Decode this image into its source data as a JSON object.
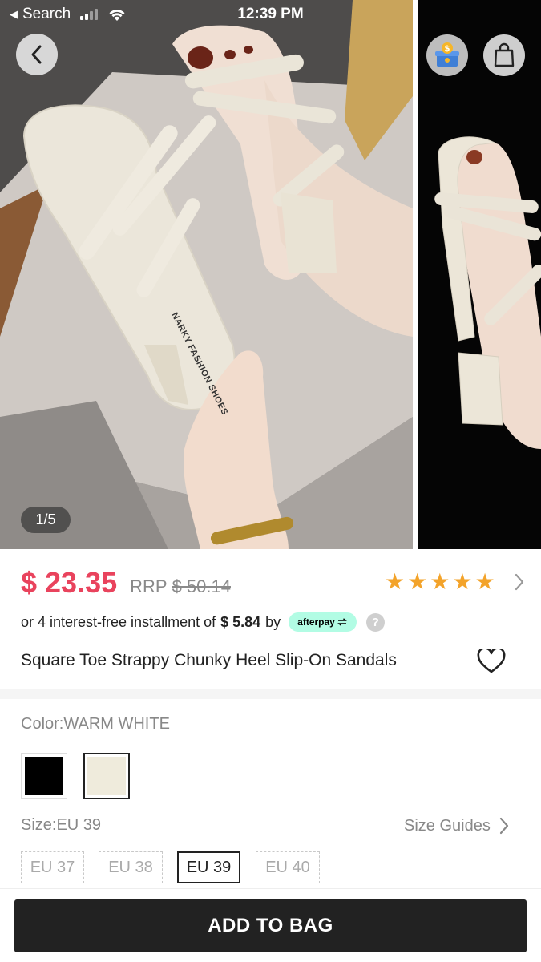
{
  "status_bar": {
    "back_app": "Search",
    "time": "12:39 PM"
  },
  "gallery": {
    "counter": "1/5",
    "insole_brand_text": "NARKY FASHION SHOES",
    "icons": {
      "back": "chevron-left-icon",
      "rewards": "gift-coin-icon",
      "bag": "shopping-bag-icon"
    }
  },
  "product": {
    "price": "$ 23.35",
    "rrp_label": "RRP",
    "rrp_value": "$ 50.14",
    "rating_stars": 5,
    "installment_prefix": "or 4 interest-free installment of",
    "installment_amount": "$ 5.84",
    "installment_by": "by",
    "afterpay_label": "afterpay",
    "title": "Square Toe Strappy Chunky Heel Slip-On Sandals"
  },
  "options": {
    "color_label": "Color:WARM WHITE",
    "colors": [
      {
        "name": "Black",
        "hex": "#000000",
        "selected": false
      },
      {
        "name": "Warm White",
        "hex": "#efebdc",
        "selected": true
      }
    ],
    "size_label": "Size:EU 39",
    "size_guides_label": "Size Guides",
    "sizes": [
      {
        "label": "EU 37",
        "selected": false
      },
      {
        "label": "EU 38",
        "selected": false
      },
      {
        "label": "EU 39",
        "selected": true
      },
      {
        "label": "EU 40",
        "selected": false
      }
    ]
  },
  "actions": {
    "add_to_bag": "ADD TO BAG"
  },
  "colors": {
    "price": "#e9435d",
    "star": "#f3a32a",
    "afterpay_bg": "#b2fce4",
    "primary_button": "#222222"
  }
}
